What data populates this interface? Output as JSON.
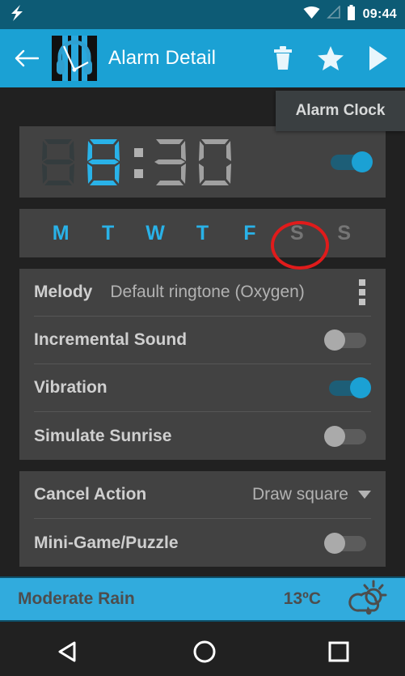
{
  "status_bar": {
    "flash_icon": "flash-icon",
    "wifi_icon": "wifi-icon",
    "signal_icon": "signal-icon",
    "battery_icon": "battery-icon",
    "time": "09:44"
  },
  "toolbar": {
    "back_icon": "back-arrow-icon",
    "app_logo": "alarm-clock-app-logo",
    "title": "Alarm Detail",
    "delete_icon": "trash-icon",
    "favorite_icon": "star-icon",
    "play_icon": "play-icon"
  },
  "tooltip": {
    "text": "Alarm Clock"
  },
  "clock": {
    "digit1": "0",
    "digit1_lit": false,
    "digit2": "8",
    "digit3": "3",
    "digit4": "0",
    "separator": ":",
    "enabled": true,
    "lit_color": "#29b2e8",
    "dim_color": "#3c4547",
    "grey_color": "#9e9e9e"
  },
  "days": [
    {
      "label": "M",
      "active": true
    },
    {
      "label": "T",
      "active": true
    },
    {
      "label": "W",
      "active": true
    },
    {
      "label": "T",
      "active": true
    },
    {
      "label": "F",
      "active": true
    },
    {
      "label": "S",
      "active": false
    },
    {
      "label": "S",
      "active": false
    }
  ],
  "annotation": {
    "shape": "red-circle",
    "color": "#e01b1b",
    "target": "saturday"
  },
  "settings": {
    "melody": {
      "label": "Melody",
      "value": "Default ringtone (Oxygen)",
      "menu_icon": "overflow-menu-icon"
    },
    "incremental_sound": {
      "label": "Incremental Sound",
      "on": false
    },
    "vibration": {
      "label": "Vibration",
      "on": true
    },
    "simulate_sunrise": {
      "label": "Simulate Sunrise",
      "on": false
    }
  },
  "cancel_action": {
    "label": "Cancel Action",
    "value": "Draw square",
    "dropdown_icon": "chevron-down-icon"
  },
  "mini_game": {
    "label": "Mini-Game/Puzzle",
    "on": false
  },
  "weather": {
    "condition": "Moderate Rain",
    "temperature": "13ºC",
    "icon": "sun-cloud-rain-icon",
    "background": "#31abdd"
  },
  "navbar": {
    "back_icon": "nav-back-icon",
    "home_icon": "nav-home-icon",
    "recents_icon": "nav-recents-icon"
  }
}
